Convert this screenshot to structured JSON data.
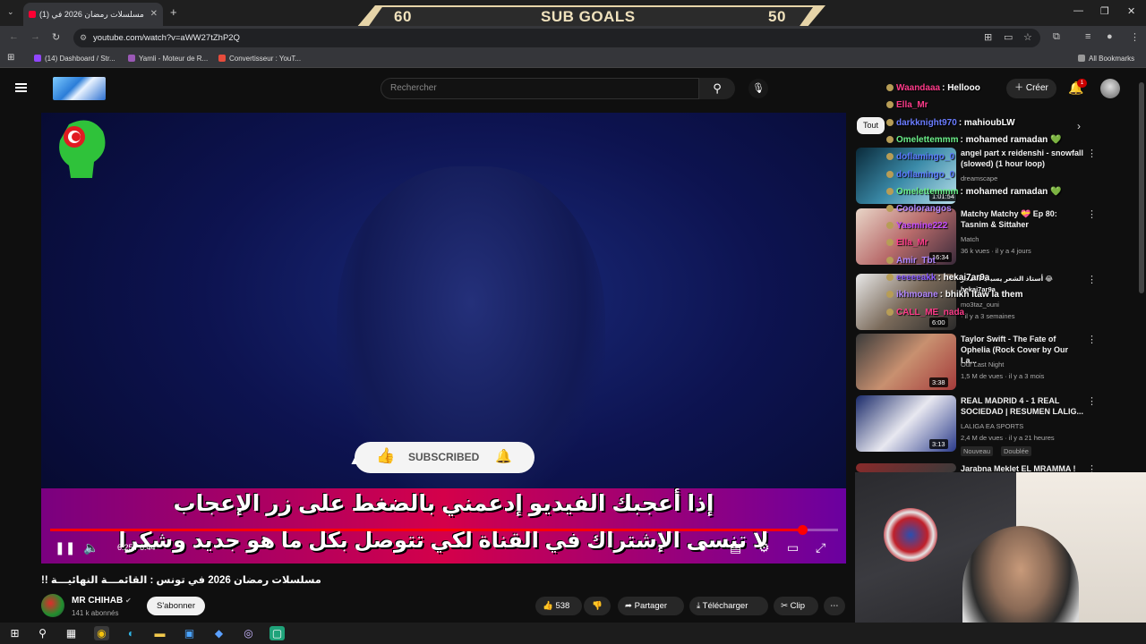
{
  "browser": {
    "tab_title": "(1) مسلسلات رمضان 2026 في",
    "url": "youtube.com/watch?v=aWW27tZhP2Q",
    "bookmarks": [
      "(14) Dashboard / Str...",
      "Yamli - Moteur de R...",
      "Convertisseur : YouT..."
    ],
    "all_bookmarks": "All Bookmarks"
  },
  "goals": {
    "left": "60",
    "label": "SUB GOALS",
    "right": "50"
  },
  "youtube": {
    "search_placeholder": "Rechercher",
    "create_label": "Créer",
    "notif_count": "1",
    "filter_all": "Tout"
  },
  "player": {
    "subscribed_label": "SUBSCRIBED",
    "caption_line1": "إذا أعجبك الفيديو إدعمني بالضغط على زر الإعجاب",
    "caption_line2": "لا تنسى الإشتراك في القناة لكي تتوصل بكل ما هو جديد وشكرا",
    "timecode": "6:25 / 6:44",
    "progress_fraction": 0.955
  },
  "video_info": {
    "title": "مسلسلات رمضان 2026 في تونس : القائمـــة النهائيـــة !!",
    "channel": "MR CHIHAB",
    "subscribers": "141 k abonnés",
    "subscribe_label": "S'abonner",
    "likes": "538",
    "share": "Partager",
    "download": "Télécharger",
    "clip": "Clip"
  },
  "recommendations": [
    {
      "title": "angel part x reidenshi - snowfall (slowed) (1 hour loop)",
      "channel": "dreamscape",
      "meta": "",
      "duration": "1:01:54"
    },
    {
      "title": "Matchy Matchy 💝 Ep 80: Tasnim & Sittaher",
      "channel": "Match",
      "meta": "36 k vues · il y a 4 jours",
      "duration": "16:34"
    },
    {
      "title": "أستاذ الشعر يسبب الضحر 😂 hekai7ar9a",
      "channel": "mo3taz_ouni",
      "meta": "· il y a 3 semaines",
      "duration": "6:00"
    },
    {
      "title": "Taylor Swift - The Fate of Ophelia (Rock Cover by Our La...",
      "channel": "Our Last Night",
      "meta": "1,5 M de vues · il y a 3 mois",
      "duration": "3:38"
    },
    {
      "title": "REAL MADRID 4 - 1 REAL SOCIEDAD | RESUMEN LALIG...",
      "channel": "LALIGA EA SPORTS",
      "meta": "2,4 M de vues · il y a 21 heures",
      "duration": "3:13",
      "badges": [
        "Nouveau",
        "Doublée"
      ]
    },
    {
      "title": "Jarabna Meklet EL MRAMMA !",
      "channel": "",
      "meta": "",
      "duration": ""
    }
  ],
  "chat": [
    {
      "user": "Waandaaa",
      "msg": ": Hellooo",
      "color": "#ff3b8a"
    },
    {
      "user": "Ella_Mr",
      "msg": "",
      "color": "#ff3b8a"
    },
    {
      "user": "darkknight970",
      "msg": ": mahioubLW",
      "color": "#6a7cff"
    },
    {
      "user": "Omelettemmm",
      "msg": ": mohamed ramadan 💚",
      "color": "#6cf08a"
    },
    {
      "user": "doflamingo_0",
      "msg": "",
      "color": "#5b7bff"
    },
    {
      "user": "doflamingo_0",
      "msg": "",
      "color": "#5b7bff"
    },
    {
      "user": "Omelettemmm",
      "msg": ": mohamed ramadan 💚",
      "color": "#6cf08a"
    },
    {
      "user": "Coolorangos",
      "msg": "",
      "color": "#b388ff"
    },
    {
      "user": "Yasmine222",
      "msg": "",
      "color": "#c64cff"
    },
    {
      "user": "Ella_Mr",
      "msg": "",
      "color": "#ff3b8a"
    },
    {
      "user": "Amir_Tbt",
      "msg": "",
      "color": "#b388ff"
    },
    {
      "user": "eeeeeakk",
      "msg": ": hekai7ar9a",
      "color": "#8a5bff"
    },
    {
      "user": "ikhmoane",
      "msg": ": bhikh ltaw la them",
      "color": "#b388ff"
    },
    {
      "user": "CALL_ME_nada",
      "msg": "",
      "color": "#ff3b8a"
    }
  ],
  "colors": {
    "accent_red": "#ff0000",
    "gold": "#e6d4a8"
  }
}
